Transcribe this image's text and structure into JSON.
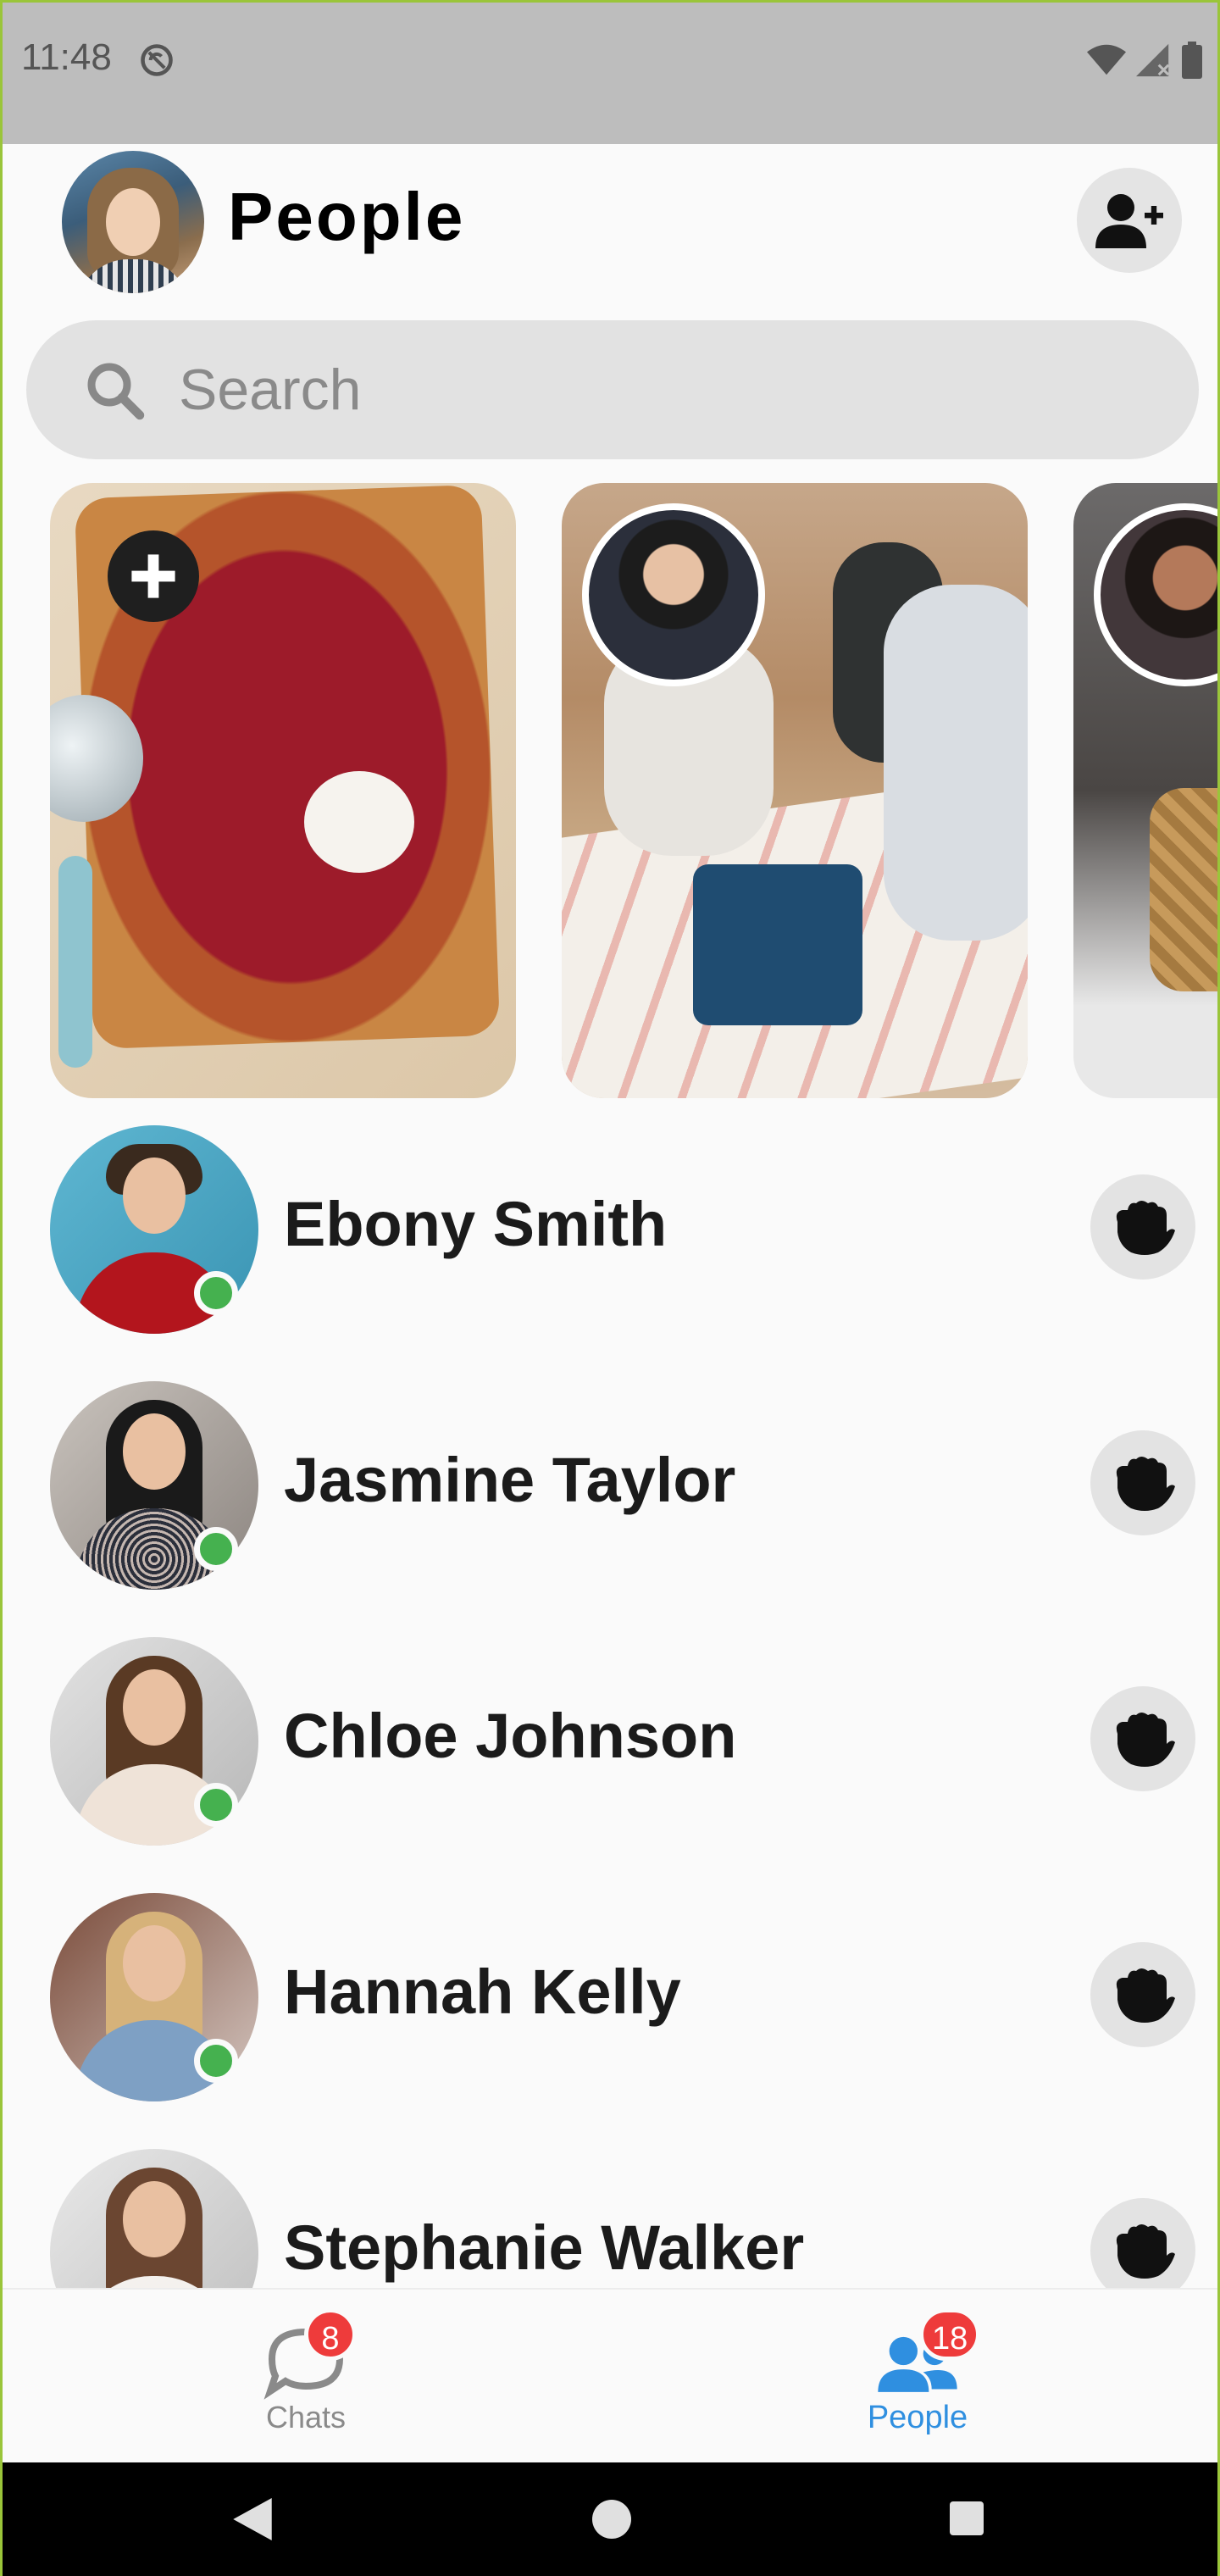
{
  "status_bar": {
    "time": "11:48"
  },
  "header": {
    "title": "People"
  },
  "search": {
    "placeholder": "Search"
  },
  "people": [
    {
      "name": "Ebony Smith",
      "online": true
    },
    {
      "name": "Jasmine Taylor",
      "online": true
    },
    {
      "name": "Chloe Johnson",
      "online": true
    },
    {
      "name": "Hannah Kelly",
      "online": true
    },
    {
      "name": "Stephanie Walker",
      "online": false
    }
  ],
  "bottom_nav": {
    "chats": {
      "label": "Chats",
      "badge": "8"
    },
    "people": {
      "label": "People",
      "badge": "18"
    }
  },
  "colors": {
    "accent": "#2f8fe0",
    "online": "#45b14f",
    "badge": "#ee3b3b"
  }
}
